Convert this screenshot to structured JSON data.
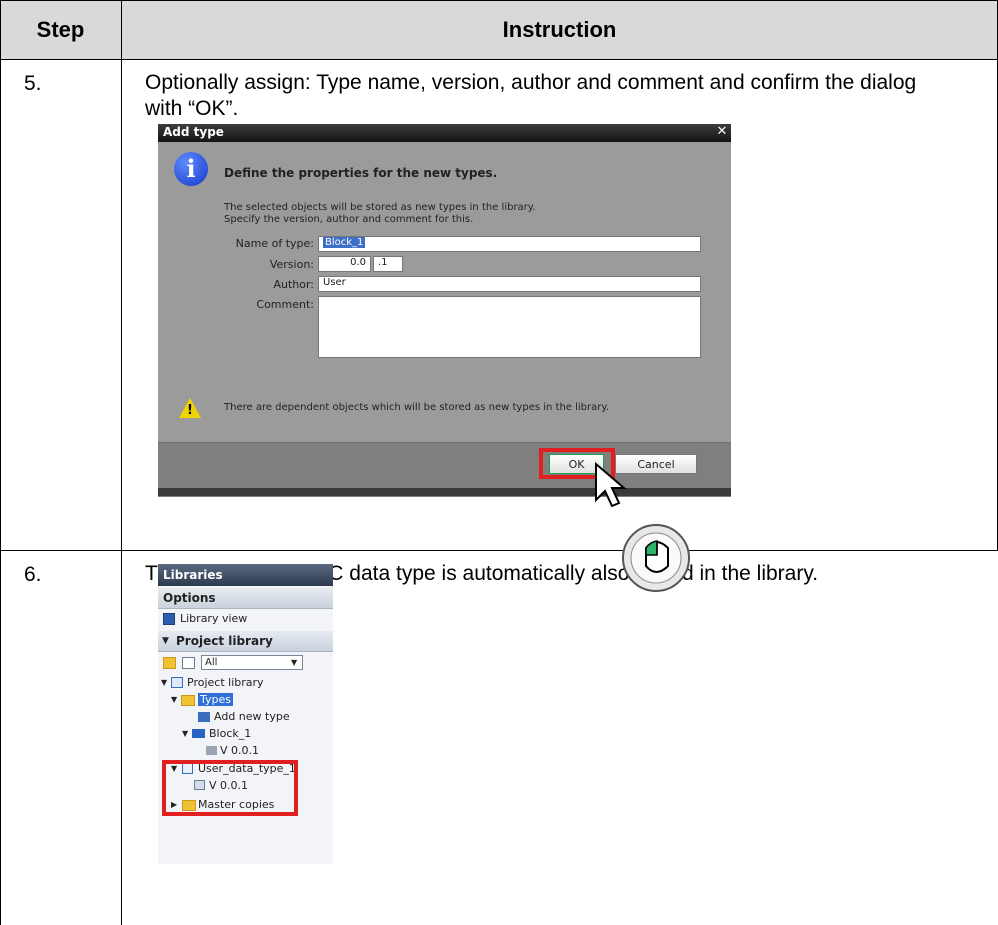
{
  "table": {
    "header_step": "Step",
    "header_instruction": "Instruction"
  },
  "rows": [
    {
      "step": "5.",
      "instruction": "Optionally assign: Type name, version, author and comment and confirm the dialog with “OK”."
    },
    {
      "step": "6.",
      "instruction": "The subordinate PLC data type is automatically also stored in the library."
    }
  ],
  "dialog": {
    "title": "Add type",
    "heading": "Define the properties for the new types.",
    "desc_line1": "The selected objects will be stored as new types in the library.",
    "desc_line2": "Specify the version, author and comment for this.",
    "name_label": "Name of type:",
    "name_value": "Block_1",
    "version_label": "Version:",
    "version_major": "0.0",
    "version_minor": ".1",
    "author_label": "Author:",
    "author_value": "User",
    "comment_label": "Comment:",
    "comment_value": "",
    "warning": "There are dependent objects which will be stored as new types in the library.",
    "ok": "OK",
    "cancel": "Cancel"
  },
  "libraries": {
    "title": "Libraries",
    "options": "Options",
    "library_view": "Library view",
    "project_library": "Project library",
    "filter": "All",
    "tree": {
      "root": "Project library",
      "types": "Types",
      "add_new_type": "Add new type",
      "block": "Block_1",
      "block_version": "V 0.0.1",
      "udt": "User_data_type_1",
      "udt_version": "V 0.0.1",
      "master_copies": "Master copies"
    }
  },
  "colors": {
    "header_bg": "#d9d9d9",
    "highlight_red": "#e02020",
    "dialog_bg": "#9b9b9b"
  }
}
